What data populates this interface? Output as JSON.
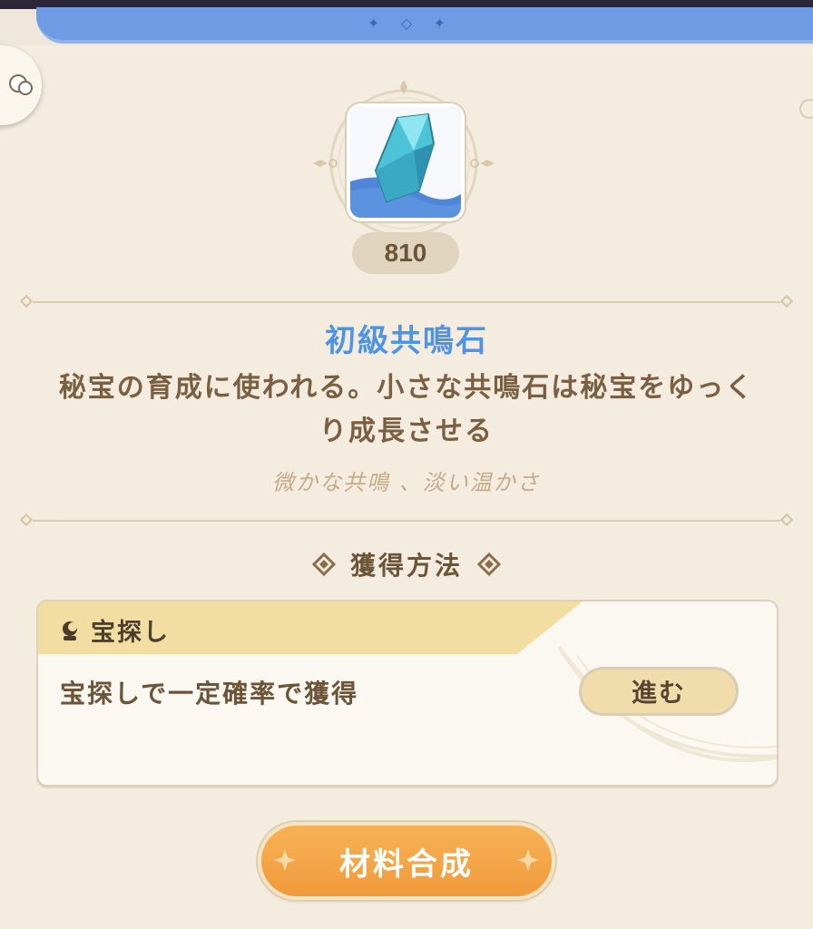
{
  "item": {
    "count": "810",
    "name": "初級共鳴石",
    "description_line1": "秘宝の育成に使われる。小さな共鳴石は秘宝をゆっく",
    "description_line2": "り成長させる",
    "flavor": "微かな共鳴 、淡い温かさ"
  },
  "acquisition": {
    "title": "獲得方法",
    "source": {
      "name": "宝探し",
      "detail": "宝探しで一定確率で獲得",
      "go_label": "進む"
    }
  },
  "actions": {
    "craft_label": "材料合成"
  },
  "colors": {
    "accent_blue": "#4f93e3",
    "craft_orange": "#f09a3b",
    "banner_blue": "#6e9ce4"
  }
}
